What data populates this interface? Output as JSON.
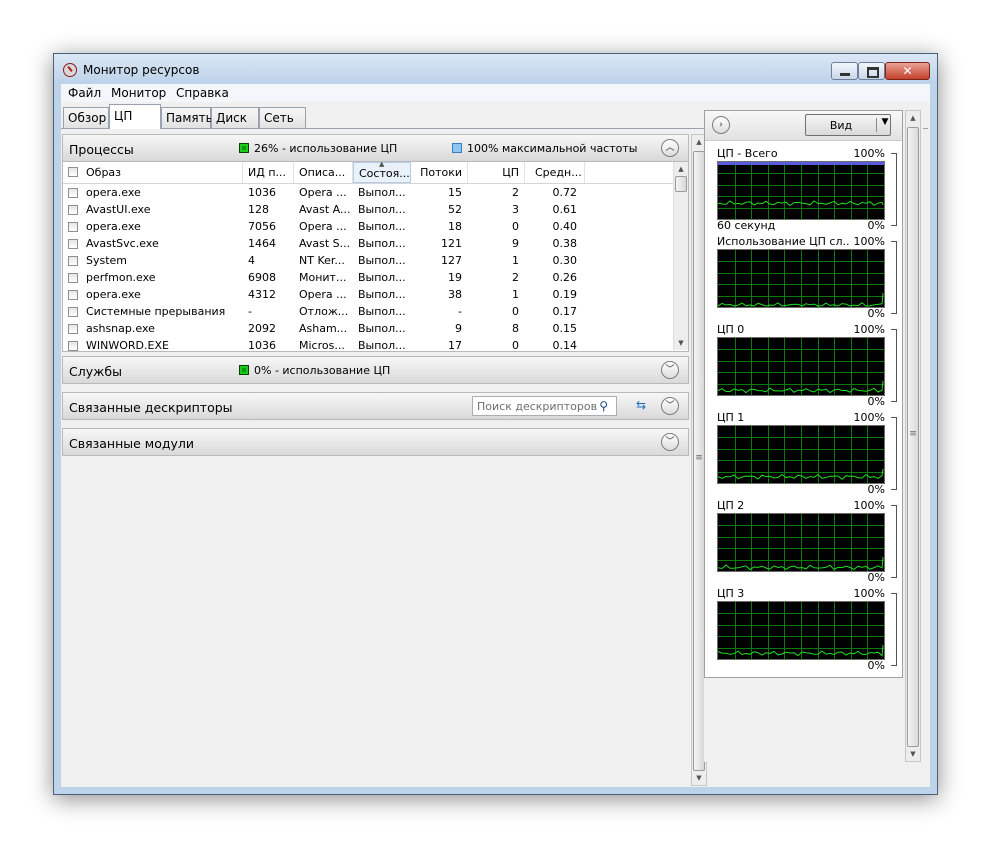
{
  "window": {
    "title": "Монитор ресурсов"
  },
  "menu": [
    "Файл",
    "Монитор",
    "Справка"
  ],
  "tabs": [
    "Обзор",
    "ЦП",
    "Память",
    "Диск",
    "Сеть"
  ],
  "active_tab": "ЦП",
  "colors": {
    "graph_background": "#000000",
    "graph_grid": "#0d7a0d",
    "graph_line": "#22e022",
    "max_freq_line": "#5a5adc"
  },
  "processes": {
    "title": "Процессы",
    "cpu_usage": "26% - использование ЦП",
    "max_freq": "100% максимальной частоты",
    "columns": [
      "Образ",
      "ИД п...",
      "Описа...",
      "Состоя...",
      "Потоки",
      "ЦП",
      "Средн..."
    ],
    "rows": [
      [
        "opera.exe",
        "1036",
        "Opera ...",
        "Выпол...",
        "15",
        "2",
        "0.72"
      ],
      [
        "AvastUI.exe",
        "128",
        "Avast A...",
        "Выпол...",
        "52",
        "3",
        "0.61"
      ],
      [
        "opera.exe",
        "7056",
        "Opera ...",
        "Выпол...",
        "18",
        "0",
        "0.40"
      ],
      [
        "AvastSvc.exe",
        "1464",
        "Avast S...",
        "Выпол...",
        "121",
        "9",
        "0.38"
      ],
      [
        "System",
        "4",
        "NT Ker...",
        "Выпол...",
        "127",
        "1",
        "0.30"
      ],
      [
        "perfmon.exe",
        "6908",
        "Монит...",
        "Выпол...",
        "19",
        "2",
        "0.26"
      ],
      [
        "opera.exe",
        "4312",
        "Opera ...",
        "Выпол...",
        "38",
        "1",
        "0.19"
      ],
      [
        "Системные прерывания",
        "-",
        "Отлож...",
        "Выпол...",
        "-",
        "0",
        "0.17"
      ],
      [
        "ashsnap.exe",
        "2092",
        "Asham...",
        "Выпол...",
        "9",
        "8",
        "0.15"
      ],
      [
        "WINWORD.EXE",
        "1036",
        "Micros...",
        "Выпол...",
        "17",
        "0",
        "0.14"
      ]
    ]
  },
  "services": {
    "title": "Службы",
    "cpu_usage": "0% - использование ЦП"
  },
  "handles": {
    "title": "Связанные дескрипторы",
    "search_placeholder": "Поиск дескрипторов"
  },
  "modules": {
    "title": "Связанные модули"
  },
  "right_panel": {
    "view_button": "Вид",
    "graphs": [
      {
        "title": "ЦП - Всего",
        "max": "100%",
        "min": "0%",
        "sub": "60 секунд",
        "level": 0.26
      },
      {
        "title": "Использование ЦП сл...",
        "max": "100%",
        "min": "0%",
        "sub": "",
        "level": 0.0
      },
      {
        "title": "ЦП 0",
        "max": "100%",
        "min": "0%",
        "sub": "",
        "level": 0.05
      },
      {
        "title": "ЦП 1",
        "max": "100%",
        "min": "0%",
        "sub": "",
        "level": 0.08
      },
      {
        "title": "ЦП 2",
        "max": "100%",
        "min": "0%",
        "sub": "",
        "level": 0.03
      },
      {
        "title": "ЦП 3",
        "max": "100%",
        "min": "0%",
        "sub": "",
        "level": 0.07
      }
    ]
  }
}
